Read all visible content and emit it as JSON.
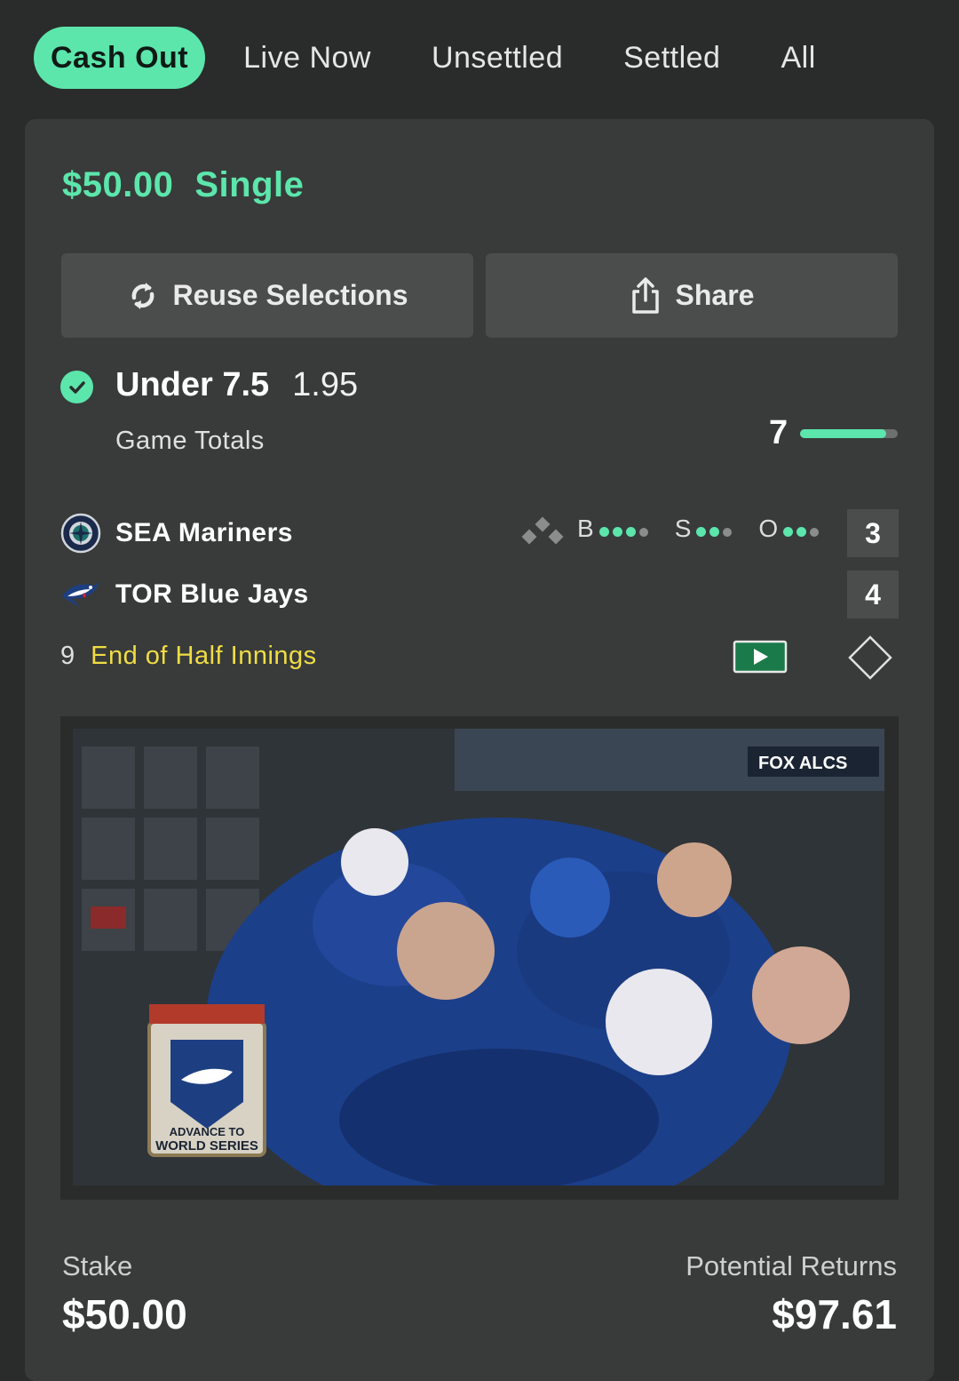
{
  "tabs": [
    {
      "label": "Cash Out",
      "active": true
    },
    {
      "label": "Live Now"
    },
    {
      "label": "Unsettled"
    },
    {
      "label": "Settled"
    },
    {
      "label": "All"
    }
  ],
  "bet": {
    "amount": "$50.00",
    "type": "Single",
    "reuse_label": "Reuse Selections",
    "share_label": "Share"
  },
  "selection": {
    "pick": "Under 7.5",
    "odds": "1.95",
    "market": "Game Totals",
    "current_total": "7",
    "total_progress": 0.88
  },
  "teams": [
    {
      "name": "SEA Mariners",
      "score": "3"
    },
    {
      "name": "TOR Blue Jays",
      "score": "4"
    }
  ],
  "count": {
    "balls_label": "B",
    "balls": 3,
    "balls_max": 4,
    "strikes_label": "S",
    "strikes": 2,
    "strikes_max": 3,
    "outs_label": "O",
    "outs": 2,
    "outs_max": 3
  },
  "game_state": {
    "inning": "9",
    "status": "End of Half Innings"
  },
  "video": {
    "broadcast_bug": "FOX ALCS",
    "overlay_text_1": "ADVANCE TO",
    "overlay_text_2": "WORLD SERIES"
  },
  "footer": {
    "stake_label": "Stake",
    "stake_value": "$50.00",
    "returns_label": "Potential Returns",
    "returns_value": "$97.61"
  },
  "colors": {
    "accent": "#5ce6ac",
    "status": "#f0dd44"
  }
}
